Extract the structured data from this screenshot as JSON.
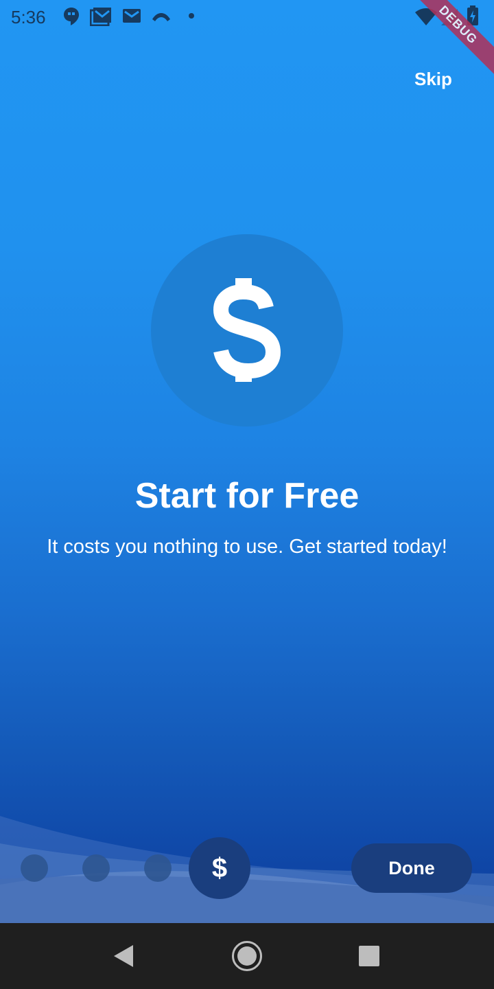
{
  "status_bar": {
    "time": "5:36",
    "left_icons": [
      "hangouts-icon",
      "gmail-stack-icon",
      "gmail-icon",
      "missed-call-icon",
      "dot-icon"
    ],
    "right_icons": [
      "wifi-icon",
      "signal-icon",
      "battery-charging-icon"
    ]
  },
  "debug_banner": "DEBUG",
  "header": {
    "skip_label": "Skip"
  },
  "slide": {
    "icon": "dollar-icon",
    "title": "Start for Free",
    "description": "It costs you nothing to use. Get started today!"
  },
  "pager": {
    "pages": 4,
    "active_index": 3,
    "active_symbol": "$",
    "done_label": "Done"
  },
  "nav_bar": {
    "icons": [
      "back-icon",
      "home-icon",
      "recents-icon"
    ]
  },
  "colors": {
    "gradient_top": "#2196F3",
    "gradient_bottom": "#0C3D9C",
    "accent_dark": "#1A3E7E",
    "debug_ribbon": "#B0325A"
  }
}
